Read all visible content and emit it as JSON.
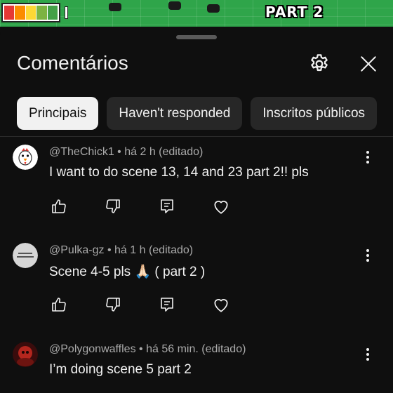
{
  "video": {
    "overlay_text": "PART 2",
    "background_color": "#2fa54a",
    "battery_colors": [
      "#e53935",
      "#fb8c00",
      "#fdd835",
      "#7cb342",
      "#43a047"
    ]
  },
  "sheet": {
    "title": "Comentários",
    "settings_icon": "gear-icon",
    "close_icon": "close-icon"
  },
  "filters": [
    {
      "label": "Principais",
      "active": true
    },
    {
      "label": "Haven't responded",
      "active": false
    },
    {
      "label": "Inscritos públicos",
      "active": false
    }
  ],
  "comments": [
    {
      "author": "@TheChick1",
      "time": "há 2 h",
      "edited": "(editado)",
      "separator": "•",
      "text": "I want to do scene 13, 14 and 23 part 2!! pls"
    },
    {
      "author": "@Pulka-gz",
      "time": "há 1 h",
      "edited": "(editado)",
      "separator": "•",
      "text": "Scene 4-5 pls 🙏🏻 ( part 2 )"
    },
    {
      "author": "@Polygonwaffles",
      "time": "há 56 min.",
      "edited": "(editado)",
      "separator": "•",
      "text": "I’m doing scene 5 part 2"
    }
  ],
  "colors": {
    "background": "#0f0f0f",
    "chip_active_bg": "#f1f1f1",
    "chip_bg": "#272727",
    "meta_text": "#aaaaaa",
    "primary_text": "#f1f1f1"
  }
}
